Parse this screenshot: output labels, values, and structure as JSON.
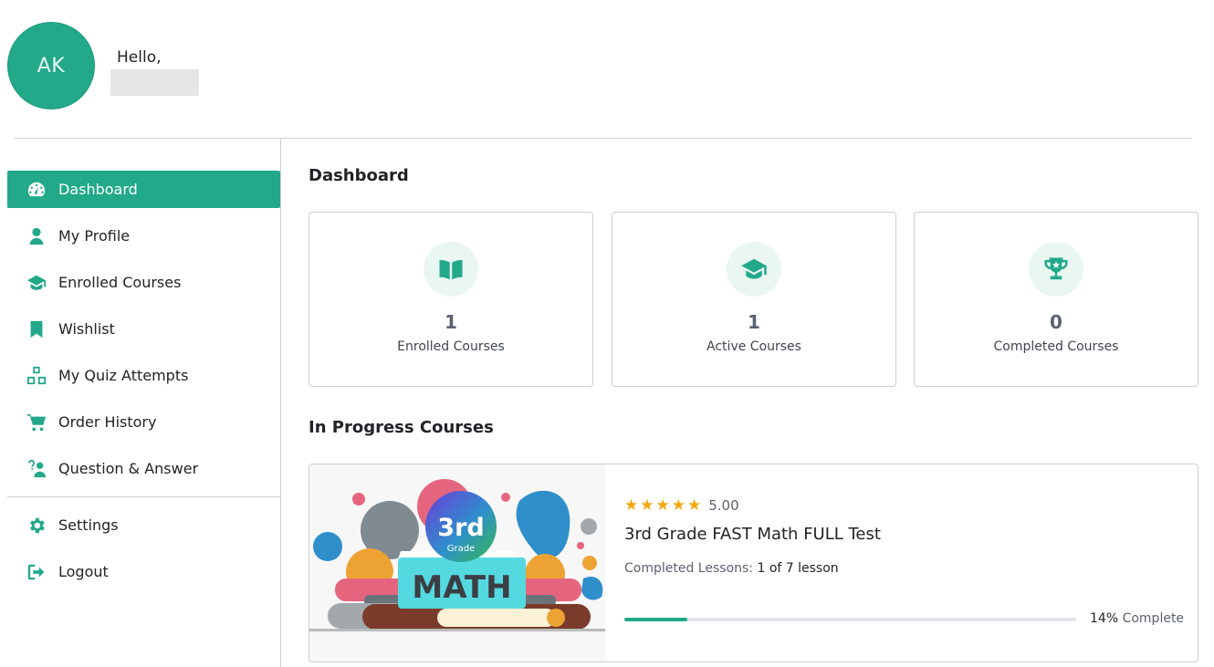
{
  "user": {
    "initials": "AK",
    "greeting": "Hello,"
  },
  "sidebar": {
    "items": [
      {
        "label": "Dashboard",
        "icon": "dashboard-icon",
        "active": true
      },
      {
        "label": "My Profile",
        "icon": "user-icon"
      },
      {
        "label": "Enrolled Courses",
        "icon": "graduation-cap-icon"
      },
      {
        "label": "Wishlist",
        "icon": "bookmark-icon"
      },
      {
        "label": "My Quiz Attempts",
        "icon": "cubes-icon"
      },
      {
        "label": "Order History",
        "icon": "cart-icon"
      },
      {
        "label": "Question & Answer",
        "icon": "question-answer-icon"
      }
    ],
    "bottom_items": [
      {
        "label": "Settings",
        "icon": "gear-icon"
      },
      {
        "label": "Logout",
        "icon": "logout-icon"
      }
    ]
  },
  "main": {
    "title": "Dashboard",
    "stats": [
      {
        "value": "1",
        "label": "Enrolled Courses",
        "icon": "book-open-icon"
      },
      {
        "value": "1",
        "label": "Active Courses",
        "icon": "graduation-cap-icon"
      },
      {
        "value": "0",
        "label": "Completed Courses",
        "icon": "trophy-icon"
      }
    ],
    "in_progress_title": "In Progress Courses",
    "course": {
      "thumb_grade": "3rd",
      "thumb_grade_word": "Grade",
      "thumb_subject": "MATH",
      "rating": "5.00",
      "stars": 5,
      "title": "3rd Grade FAST Math FULL Test",
      "lessons_label": "Completed Lessons:",
      "lessons_value": "1 of 7 lesson",
      "progress_percent": 14,
      "progress_pct_text": "14%",
      "progress_suffix": "Complete"
    }
  },
  "colors": {
    "accent": "#22a98a",
    "star": "#f4a70c"
  }
}
